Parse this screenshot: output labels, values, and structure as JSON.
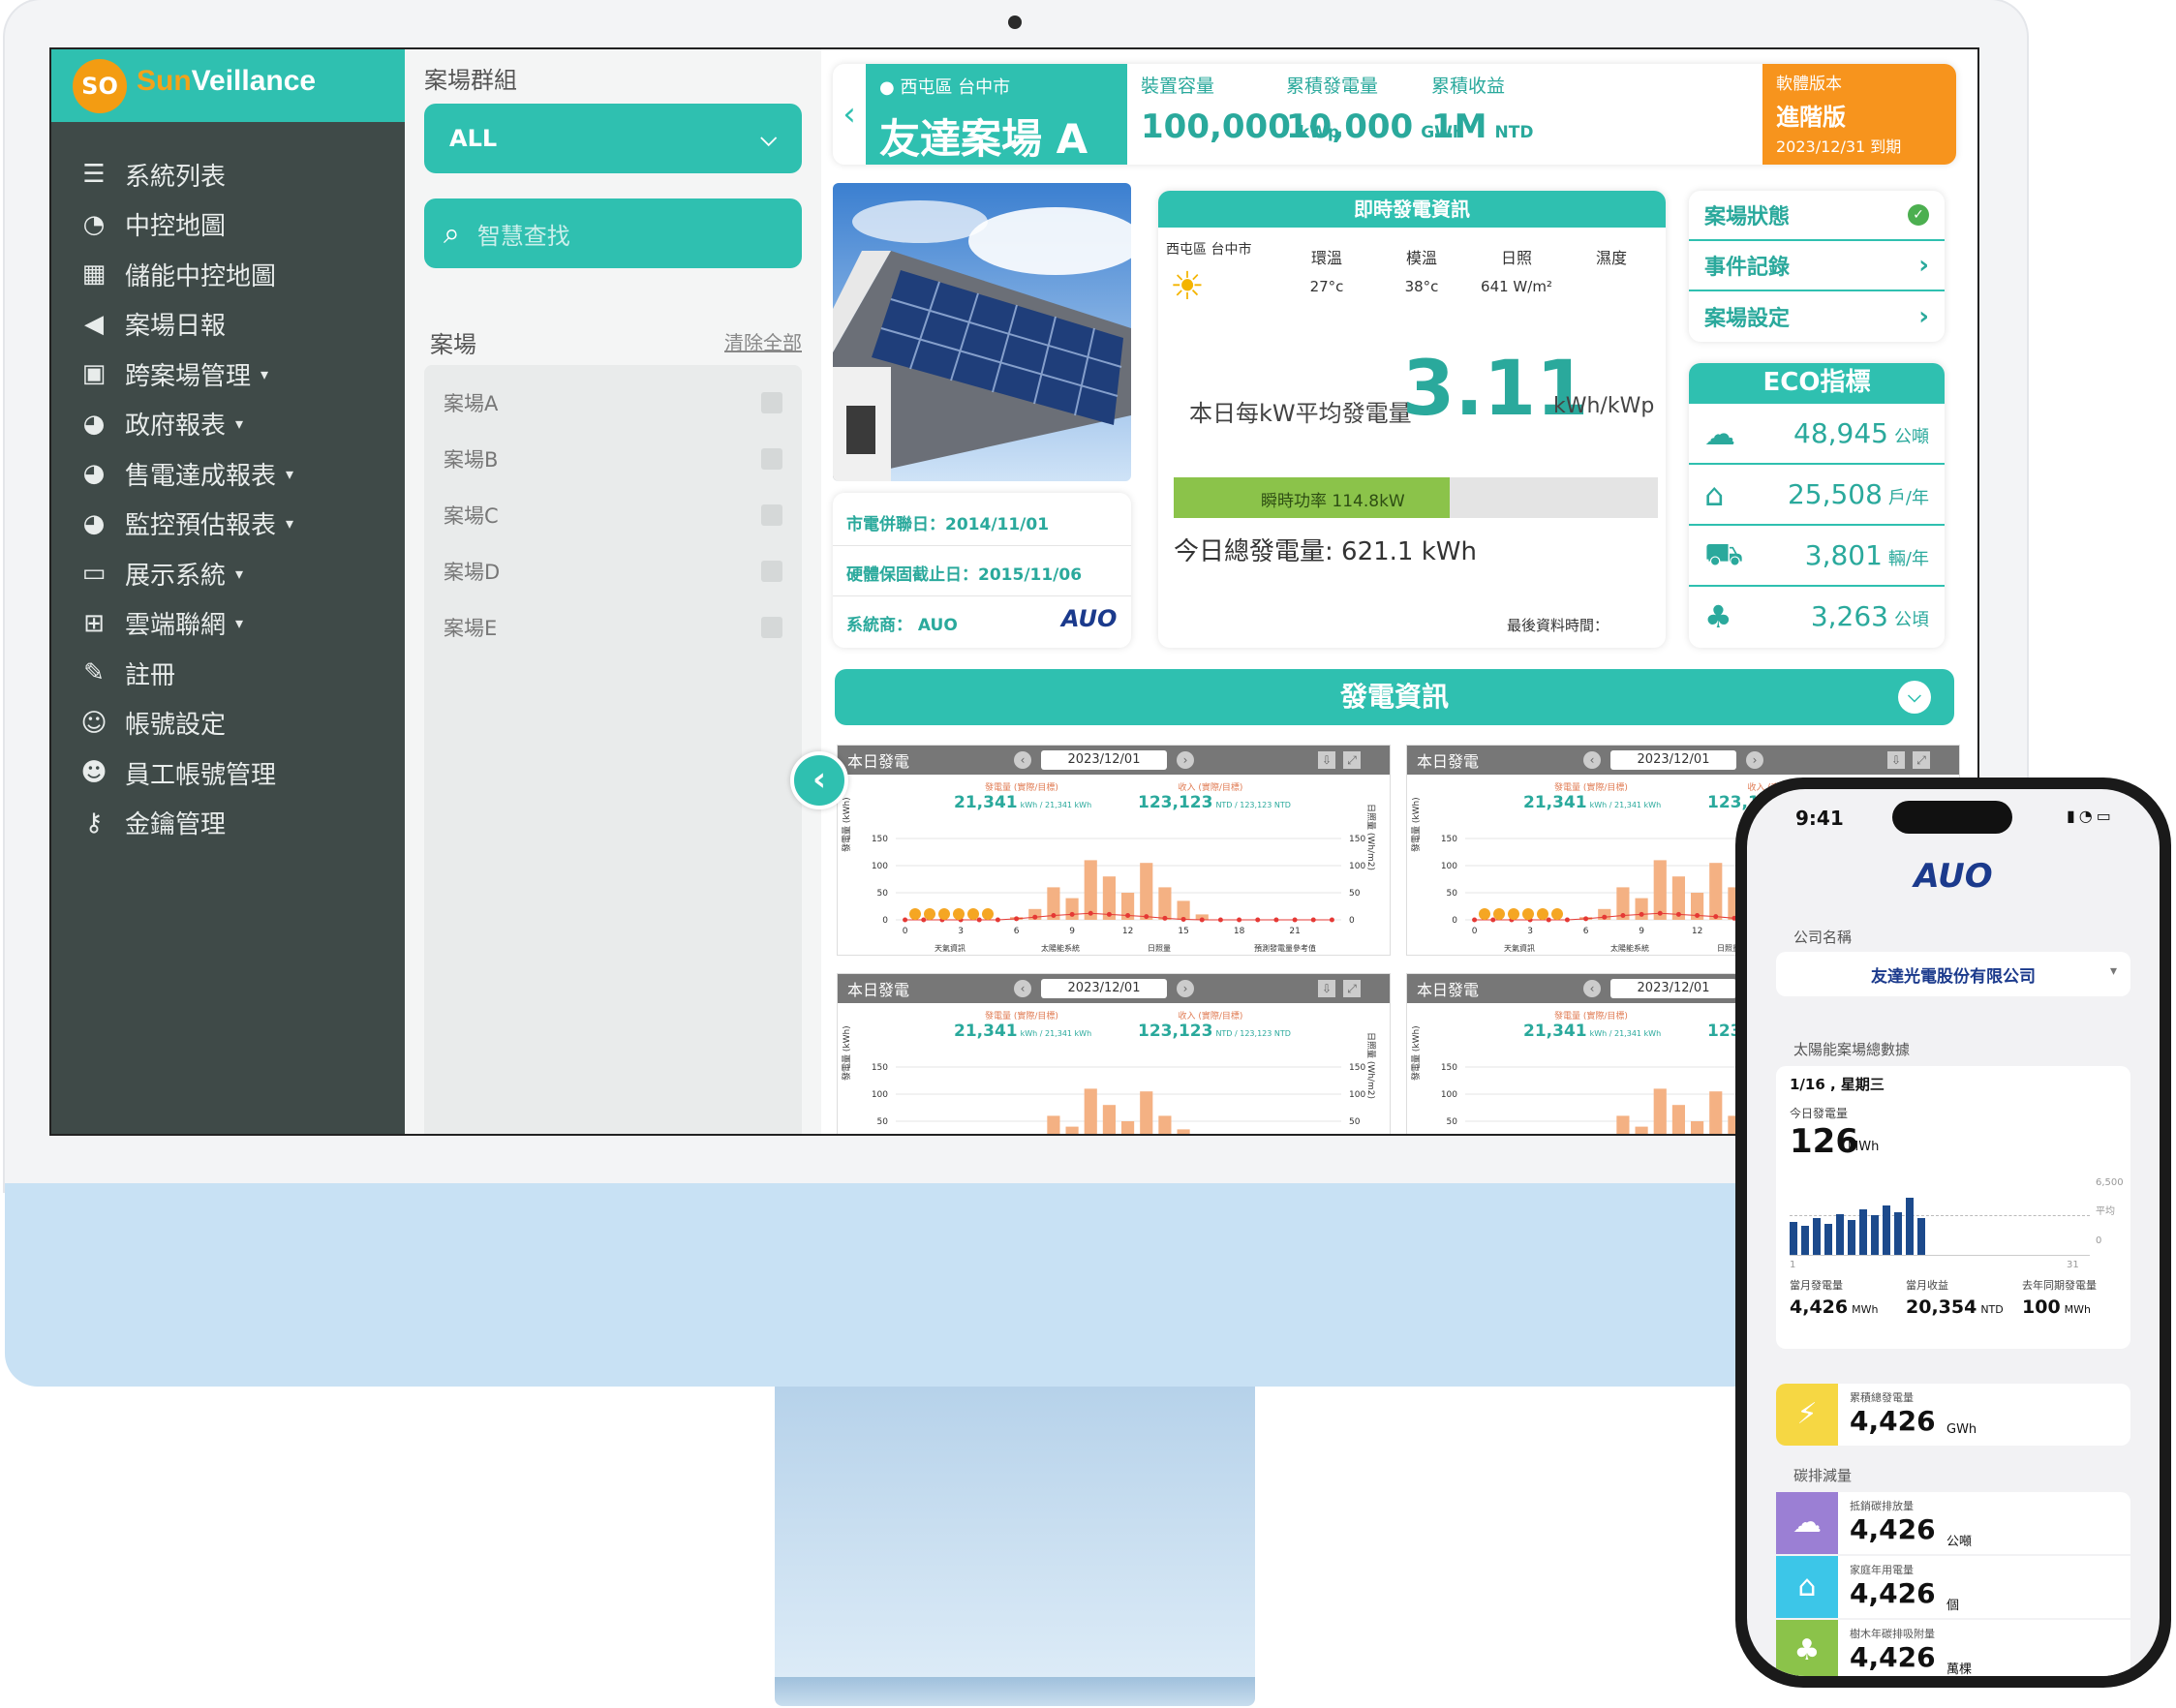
{
  "app": {
    "logo_mark": "SO",
    "brand_prefix": "Sun",
    "brand_suffix": "Veillance"
  },
  "sidebar": {
    "items": [
      {
        "icon": "list-icon",
        "glyph": "☰",
        "label": "系統列表",
        "caret": ""
      },
      {
        "icon": "dashboard-icon",
        "glyph": "◔",
        "label": "中控地圖",
        "caret": ""
      },
      {
        "icon": "storage-icon",
        "glyph": "▦",
        "label": "儲能中控地圖",
        "caret": ""
      },
      {
        "icon": "megaphone-icon",
        "glyph": "◀",
        "label": "案場日報",
        "caret": ""
      },
      {
        "icon": "truck-icon",
        "glyph": "▣",
        "label": "跨案場管理",
        "caret": "▾"
      },
      {
        "icon": "pie-chart-icon",
        "glyph": "◕",
        "label": "政府報表",
        "caret": "▾"
      },
      {
        "icon": "pie-chart-icon",
        "glyph": "◕",
        "label": "售電達成報表",
        "caret": "▾"
      },
      {
        "icon": "pie-chart-icon",
        "glyph": "◕",
        "label": "監控預估報表",
        "caret": "▾"
      },
      {
        "icon": "monitor-icon",
        "glyph": "▭",
        "label": "展示系統",
        "caret": "▾"
      },
      {
        "icon": "network-icon",
        "glyph": "⊞",
        "label": "雲端聯網",
        "caret": "▾"
      },
      {
        "icon": "pencil-icon",
        "glyph": "✎",
        "label": "註冊",
        "caret": ""
      },
      {
        "icon": "user-gear-icon",
        "glyph": "☺",
        "label": "帳號設定",
        "caret": ""
      },
      {
        "icon": "users-icon",
        "glyph": "☻",
        "label": "員工帳號管理",
        "caret": ""
      },
      {
        "icon": "key-icon",
        "glyph": "⚷",
        "label": "金鑰管理",
        "caret": ""
      }
    ]
  },
  "filter": {
    "group_label": "案場群組",
    "group_value": "ALL",
    "search_placeholder": "智慧查找",
    "sites_label": "案場",
    "clear_all": "清除全部",
    "sites": [
      "案場A",
      "案場B",
      "案場C",
      "案場D",
      "案場E"
    ]
  },
  "header": {
    "location": "西屯區 台中市",
    "site_name": "友達案場 A",
    "stats": [
      {
        "label": "裝置容量",
        "value": "100,000",
        "unit": "kWp"
      },
      {
        "label": "累積發電量",
        "value": "10,000",
        "unit": "GWh"
      },
      {
        "label": "累積收益",
        "value": "1M",
        "unit": "NTD"
      }
    ],
    "version_label": "軟體版本",
    "version_value": "進階版",
    "version_expiry": "2023/12/31 到期"
  },
  "site_info": {
    "grid_date": "市電併聯日：2014/11/01",
    "warranty": "硬體保固截止日：2015/11/06",
    "vendor": "系統商： AUO",
    "vendor_logo": "AUO"
  },
  "realtime": {
    "title": "即時發電資訊",
    "location": "西屯區 台中市",
    "metrics": [
      {
        "label": "環溫",
        "value": "27°c"
      },
      {
        "label": "模溫",
        "value": "38°c"
      },
      {
        "label": "日照",
        "value": "641 W/m²"
      },
      {
        "label": "濕度",
        "value": ""
      }
    ],
    "avg_label": "本日每kW平均發電量",
    "avg_value": "3.11",
    "avg_unit": "kWh/kWp",
    "power_label": "瞬時功率 114.8kW",
    "power_fraction": 0.57,
    "total_label": "今日總發電量: 621.1 kWh",
    "last_update": "最後資料時間："
  },
  "status_panel": {
    "items": [
      "案場狀態",
      "事件記錄",
      "案場設定"
    ]
  },
  "eco": {
    "title": "ECO指標",
    "rows": [
      {
        "icon": "co2-cloud-icon",
        "glyph": "☁",
        "value": "48,945",
        "unit": "公噸"
      },
      {
        "icon": "house-icon",
        "glyph": "⌂",
        "value": "25,508",
        "unit": "戶/年"
      },
      {
        "icon": "car-icon",
        "glyph": "⛟",
        "value": "3,801",
        "unit": "輛/年"
      },
      {
        "icon": "tree-icon",
        "glyph": "♣",
        "value": "3,263",
        "unit": "公頃"
      }
    ]
  },
  "power_section": {
    "title": "發電資訊"
  },
  "chart_panel": {
    "title": "本日發電",
    "date": "2023/12/01",
    "gen_label": "發電量 (實際/目標)",
    "gen_value": "21,341",
    "gen_sub": "kWh / 21,341 kWh",
    "rev_label": "收入 (實際/目標)",
    "rev_value": "123,123",
    "rev_sub": "NTD / 123,123 NTD",
    "ylabel_left": "發電量 (kWh)",
    "ylabel_right": "日照量 (Wh/m2)",
    "legend": [
      "天氣資訊",
      "太陽能系統",
      "日照量",
      "預測發電量參考值"
    ]
  },
  "chart_data": {
    "type": "bar",
    "title": "本日發電",
    "x": [
      0,
      3,
      6,
      9,
      12,
      15,
      18,
      21
    ],
    "ylim": [
      0,
      150
    ],
    "yticks": [
      0,
      50,
      100,
      150
    ],
    "series": [
      {
        "name": "太陽能系統",
        "values": [
          0,
          0,
          0,
          0,
          0,
          0,
          5,
          20,
          60,
          40,
          110,
          80,
          50,
          105,
          60,
          35,
          10,
          0,
          0,
          0,
          0,
          0,
          0,
          0
        ]
      },
      {
        "name": "日照量",
        "values": [
          0,
          0,
          0,
          0,
          0,
          0,
          2,
          5,
          8,
          10,
          12,
          10,
          8,
          6,
          3,
          1,
          0,
          0,
          0,
          0,
          0,
          0,
          0,
          0
        ]
      }
    ]
  },
  "phone": {
    "time": "9:41",
    "logo": "AUO",
    "company_label": "公司名稱",
    "company_value": "友達光電股份有限公司",
    "section_label": "太陽能案場總數據",
    "date": "1/16 , 星期三",
    "today_label": "今日發電量",
    "today_value": "126",
    "today_unit": "MWh",
    "chart_right": [
      "6,500",
      "平均",
      "0"
    ],
    "chart_axis": [
      "1",
      "31"
    ],
    "chart_bars": [
      0.4,
      0.35,
      0.45,
      0.38,
      0.5,
      0.42,
      0.55,
      0.48,
      0.6,
      0.52,
      0.7,
      0.45
    ],
    "stats": [
      {
        "label": "當月發電量",
        "value": "4,426",
        "unit": "MWh"
      },
      {
        "label": "當月收益",
        "value": "20,354",
        "unit": "NTD"
      },
      {
        "label": "去年同期發電量",
        "value": "100",
        "unit": "MWh"
      }
    ],
    "cumulative_label": "累積總發電量",
    "cumulative_value": "4,426",
    "cumulative_unit": "GWh",
    "carbon_label": "碳排減量",
    "carbon": [
      {
        "label": "抵銷碳排放量",
        "value": "4,426",
        "unit": "公噸",
        "color": "#9b7fd4"
      },
      {
        "label": "家庭年用電量",
        "value": "4,426",
        "unit": "個",
        "color": "#3cc6e8"
      },
      {
        "label": "樹木年碳排吸附量",
        "value": "4,426",
        "unit": "萬棵",
        "color": "#8bc34a"
      }
    ]
  }
}
